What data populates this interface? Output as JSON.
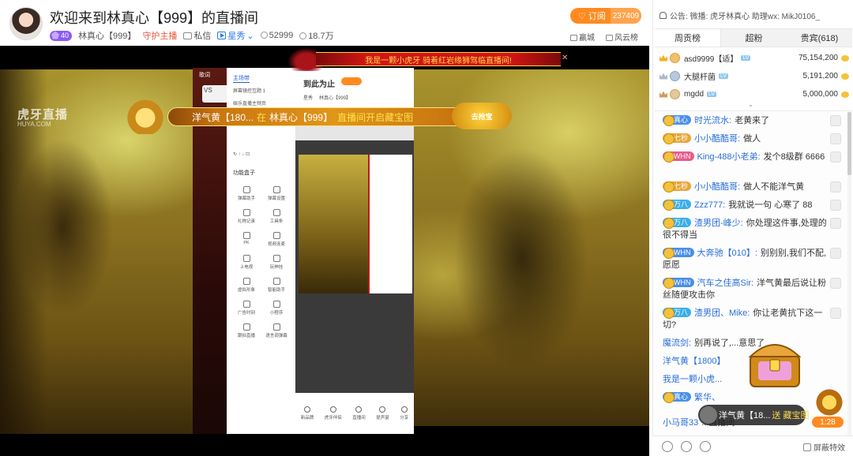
{
  "header": {
    "room_title": "欢迎来到林真心【999】的直播间",
    "level": "40",
    "streamer": "林真心【999】",
    "guard": "守护主播",
    "message": "私信",
    "category": "星秀",
    "viewers": "52999",
    "followers": "18.7万",
    "subscribe_label": "订阅",
    "subscribe_count": "237409",
    "link_city": "赢城",
    "link_wind": "风云榜"
  },
  "player": {
    "top_banner": "我是一颗小虎牙 骑着红岩缘狮驾临直播间!",
    "treasure_user": "洋气黄【180...",
    "treasure_at": "在",
    "treasure_room": "林真心【999】",
    "treasure_action": "直播间开启藏宝图",
    "treasure_btn": "去抢宝",
    "screen": {
      "lyrics": "歌词",
      "panel_tab": "主场带",
      "row1": "屏幕镜控互题 1",
      "row2": "娱乐直播主频页",
      "box_title": "功能盒子",
      "tools": [
        "弹幕助手",
        "弹幕设置",
        "礼物记录",
        "工具条",
        "PK",
        "视频连麦",
        "上电视",
        "玩神挂",
        "虚拟形象",
        "智能助手",
        "广告时刻",
        "小程序",
        "跟拍直播",
        "语言调弹幕"
      ],
      "pm_title": "到此为止",
      "pm_tag": "星秀",
      "pm_name": "林真心【999】",
      "bottom": [
        "新品牌",
        "虎牙伴侣",
        "直播间",
        "提声宴",
        "分享"
      ]
    }
  },
  "sidebar": {
    "notice": "公告: 微播: 虎牙林真心 助理wx: MikJ0106_",
    "tabs": [
      "周贡榜",
      "超粉",
      "贵宾(618)"
    ],
    "rank": [
      {
        "name": "asd9999【适】",
        "score": "75,154,200"
      },
      {
        "name": "大腿杆菌",
        "score": "5,191,200"
      },
      {
        "name": "mgdd",
        "score": "5,000,000"
      }
    ],
    "chat": [
      {
        "badge": "真心",
        "badge_color": "#4a8fe8",
        "nick": "时光流水:",
        "text": "老黄来了"
      },
      {
        "badge": "七秒",
        "badge_color": "#e8a53a",
        "nick": "小小酷酷哥:",
        "text": "做人"
      },
      {
        "badge": "WHN",
        "badge_color": "#e85a8a",
        "nick": "King-488小老弟:",
        "text": "发个8级群 6666"
      },
      {
        "badge": "七秒",
        "badge_color": "#e8a53a",
        "nick": "小小酷酷哥:",
        "text": "做人不能洋气黄"
      },
      {
        "badge": "万八",
        "badge_color": "#3aaee8",
        "nick": "Zzz777:",
        "text": "我就说一句 心寒了 88"
      },
      {
        "badge": "万八",
        "badge_color": "#3aaee8",
        "nick": "渣男团-峰少:",
        "text": "你处理这件事,处理的很不得当"
      },
      {
        "badge": "WHN",
        "badge_color": "#4a8fe8",
        "nick": "大奔驰【010】:",
        "text": "别别别,我们不配,愿愿"
      },
      {
        "badge": "WHN",
        "badge_color": "#4a8fe8",
        "nick": "汽车之佳高Sir:",
        "text": "洋气黄最后说让粉丝随便攻击你"
      },
      {
        "badge": "万八",
        "badge_color": "#3aaee8",
        "nick": "渣男团、Mike:",
        "text": "你让老黄抗下这一切?"
      },
      {
        "badge": "",
        "badge_color": "",
        "nick": "魔流剑:",
        "text": "别再说了,...意思了"
      },
      {
        "badge": "",
        "badge_color": "",
        "nick": "洋气黄【1800】",
        "text": ""
      },
      {
        "badge": "",
        "badge_color": "",
        "nick": "我是一颗小虎...",
        "text": ""
      },
      {
        "badge": "真心",
        "badge_color": "#4a8fe8",
        "nick": "繁华、",
        "text": ""
      },
      {
        "badge": "",
        "badge_color": "",
        "nick": "小马哥33",
        "text": "...直播间"
      }
    ],
    "live_user": "洋气黄【18...",
    "live_action": "送 藏宝图",
    "timer": "1:28",
    "shield": "屏蔽特效"
  }
}
